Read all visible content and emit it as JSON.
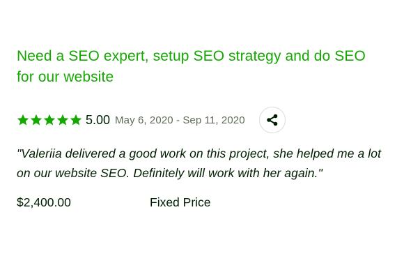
{
  "job": {
    "title": "Need a SEO expert, setup SEO strategy and do SEO for our website",
    "rating": {
      "stars": 5,
      "max_stars": 5,
      "value_label": "5.00",
      "star_color": "#14a800"
    },
    "date_range": "May 6, 2020 - Sep 11, 2020",
    "share_icon": "share-icon",
    "feedback": "\"Valeriia delivered a good work on this project, she helped me a lot on our website SEO. Definitely will work with her again.\"",
    "price": "$2,400.00",
    "price_type": "Fixed Price"
  },
  "colors": {
    "accent": "#14a800",
    "text": "#001e00",
    "muted": "#5e6d55",
    "border": "#d5e0d5"
  }
}
